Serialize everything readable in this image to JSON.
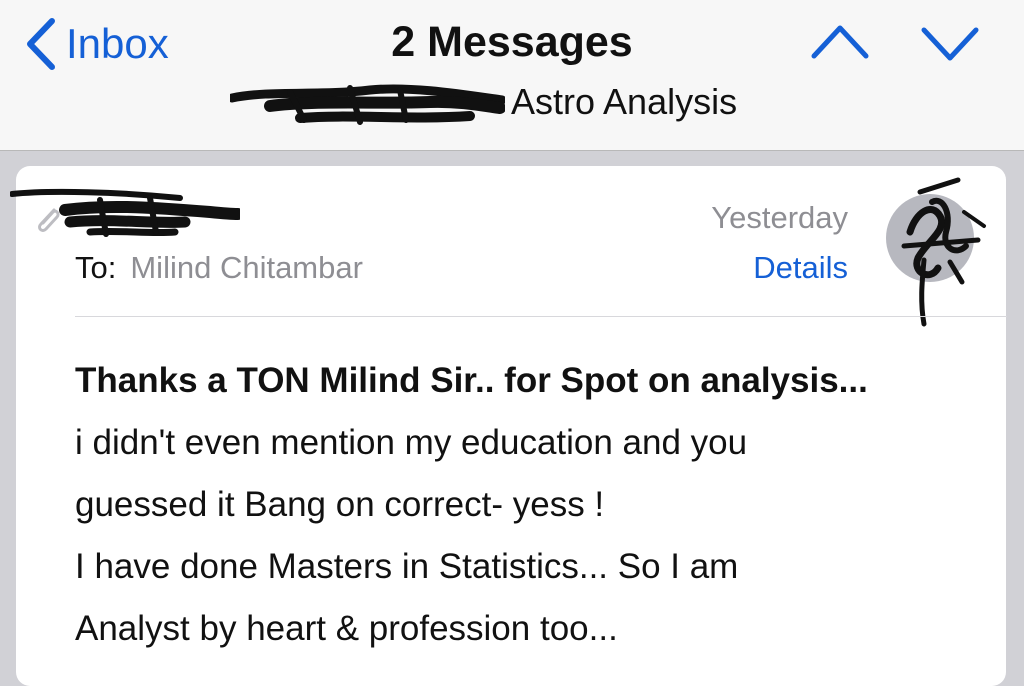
{
  "navbar": {
    "back_label": "Inbox",
    "title": "2 Messages",
    "subject_suffix": "Astro Analysis"
  },
  "message": {
    "to_label": "To:",
    "to_name": "Milind Chitambar",
    "date": "Yesterday",
    "details_label": "Details",
    "body_lines": [
      "Thanks a TON Milind Sir.. for Spot on analysis...",
      "i didn't even mention my education and you",
      "guessed it Bang on correct- yess !",
      "I have done Masters in Statistics... So I am",
      "Analyst by heart & profession too..."
    ]
  },
  "colors": {
    "accent": "#1560d6",
    "navbar_bg": "#f7f7f7",
    "page_bg": "#d1d1d6",
    "secondary_text": "#8e8e93"
  },
  "icons": {
    "back": "chevron-left-icon",
    "previous": "chevron-up-icon",
    "next": "chevron-down-icon",
    "attachment": "paperclip-icon"
  }
}
